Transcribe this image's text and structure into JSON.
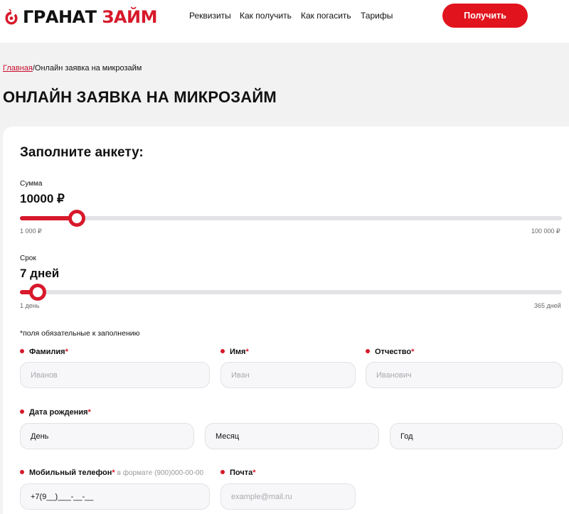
{
  "header": {
    "logo_word1": "ГРАНАТ",
    "logo_word2": "ЗАЙМ",
    "nav": [
      "Реквизиты",
      "Как получить",
      "Как погасить",
      "Тарифы"
    ],
    "cta_label": "Получить"
  },
  "breadcrumb": {
    "home": "Главная",
    "current": "/Онлайн заявка на микрозайм"
  },
  "page_title": "ОНЛАЙН ЗАЯВКА НА МИКРОЗАЙМ",
  "form": {
    "title": "Заполните анкету:",
    "amount": {
      "label": "Сумма",
      "value": "10000 ₽",
      "min": "1 000 ₽",
      "max": "100 000 ₽",
      "level": 0.1
    },
    "term": {
      "label": "Срок",
      "value": "7 дней",
      "min": "1 день",
      "max": "365 дней",
      "level": 0.03
    },
    "required_note": "*поля обязательные к заполнению",
    "surname": {
      "label": "Фамилия",
      "placeholder": "Иванов"
    },
    "name": {
      "label": "Имя",
      "placeholder": "Иван"
    },
    "patronymic": {
      "label": "Отчество",
      "placeholder": "Иванович"
    },
    "birthdate": {
      "label": "Дата рождения",
      "day": "День",
      "month": "Месяц",
      "year": "Год"
    },
    "phone": {
      "label": "Мобильный телефон",
      "hint": "в формате (900)000-00-00",
      "value": "+7(9__)___-__-__"
    },
    "email": {
      "label": "Почта",
      "placeholder": "example@mail.ru"
    },
    "required_mark": "*"
  },
  "colors": {
    "accent": "#d7192b",
    "button": "#e1141d",
    "page_bg": "#f2f2f3"
  }
}
